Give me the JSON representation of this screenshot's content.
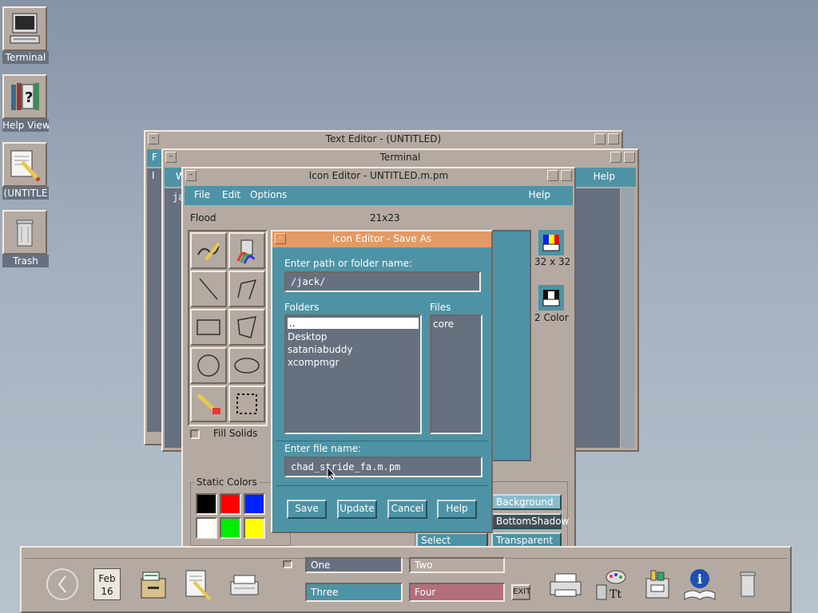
{
  "desktop": {
    "icons": [
      {
        "label": "Terminal",
        "icon": "terminal-icon"
      },
      {
        "label": "Help View",
        "icon": "help-books-icon"
      },
      {
        "label": "(UNTITLE",
        "icon": "notepad-pencil-icon"
      },
      {
        "label": "Trash",
        "icon": "trash-can-icon"
      }
    ]
  },
  "text_editor": {
    "title": "Text Editor - (UNTITLED)",
    "menu_letter": "F",
    "cursor_mark": "I"
  },
  "terminal": {
    "title": "Terminal",
    "menu_letter": "W",
    "help": "Help",
    "line_start": "ja"
  },
  "icon_editor": {
    "title": "Icon Editor - UNTITLED.m.pm",
    "menu": {
      "file": "File",
      "edit": "Edit",
      "options": "Options",
      "help": "Help"
    },
    "mode": "Flood",
    "size": "21x23",
    "fill_solids": "Fill Solids",
    "static_colors": "Static Colors",
    "preview_color": {
      "label": "32 x 32"
    },
    "preview_mono": {
      "label": "2 Color"
    },
    "dynamic_colors": {
      "background": "Background",
      "bottom_shadow": "BottomShadow",
      "select": "Select",
      "transparent": "Transparent"
    },
    "colors": {
      "black": "#000000",
      "red": "#ff0000",
      "blue": "#0022ff",
      "white": "#ffffff",
      "green": "#00ee00",
      "yellow": "#ffff00"
    }
  },
  "save_dialog": {
    "title": "Icon Editor - Save As",
    "path_label": "Enter path or folder name:",
    "path_value": "/jack/",
    "folders_label": "Folders",
    "folders": [
      "..",
      "Desktop",
      "sataniabuddy",
      "xcompmgr"
    ],
    "files_label": "Files",
    "files": [
      "core"
    ],
    "filename_label": "Enter file name:",
    "filename_value": "chad_stride_fa.m.pm",
    "buttons": {
      "save": "Save",
      "update": "Update",
      "cancel": "Cancel",
      "help": "Help"
    }
  },
  "front_panel": {
    "date_month": "Feb",
    "date_day": "16",
    "workspaces": [
      "One",
      "Two",
      "Three",
      "Four"
    ],
    "exit": "EXIT"
  }
}
